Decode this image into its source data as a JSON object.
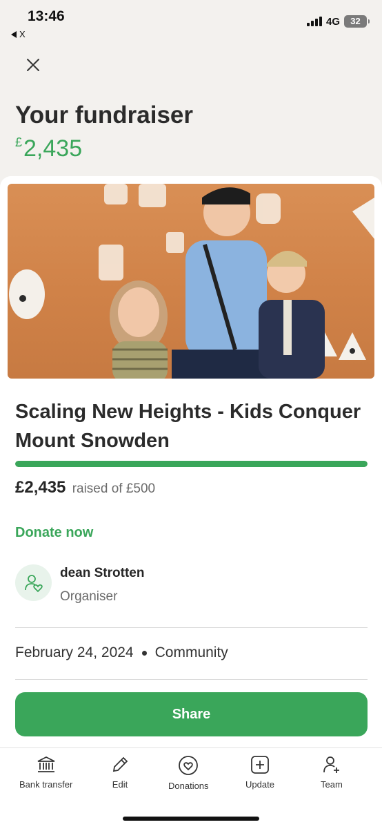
{
  "status_bar": {
    "time": "13:46",
    "back_label": "X",
    "network": "4G",
    "battery": "32"
  },
  "header": {
    "title": "Your fundraiser",
    "amount_currency": "£",
    "amount_value": "2,435"
  },
  "fundraiser": {
    "title": "Scaling New Heights - Kids Conquer Mount Snowden",
    "raised_amount": "£2,435",
    "raised_suffix": "raised of £500",
    "progress_fraction": 1.0,
    "donate_label": "Donate now",
    "organiser_name": "dean Strotten",
    "organiser_role": "Organiser",
    "date": "February 24, 2024",
    "category": "Community",
    "share_label": "Share"
  },
  "bottom_nav": {
    "items": [
      {
        "label": "Bank transfer",
        "icon": "bank-icon"
      },
      {
        "label": "Edit",
        "icon": "pencil-icon"
      },
      {
        "label": "Donations",
        "icon": "heart-circle-icon"
      },
      {
        "label": "Update",
        "icon": "plus-square-icon"
      },
      {
        "label": "Team",
        "icon": "add-person-icon"
      }
    ]
  },
  "colors": {
    "accent": "#3aa65a",
    "background": "#f3f1ee",
    "hero_orange": "#d08248"
  }
}
